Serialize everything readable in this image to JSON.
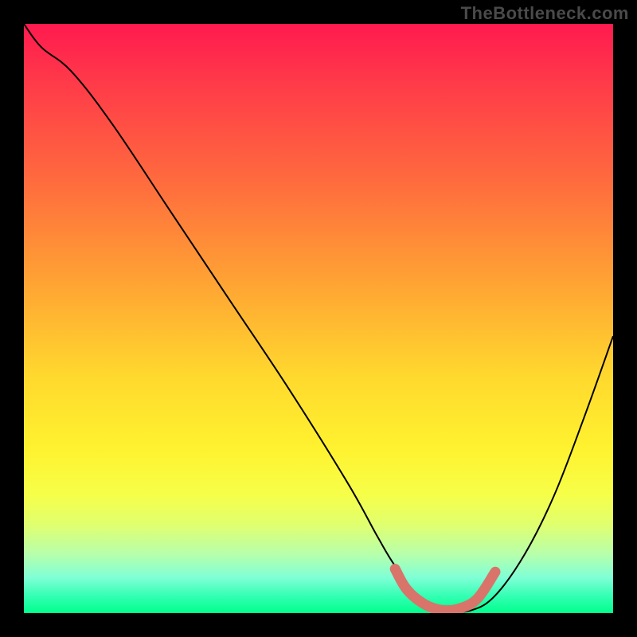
{
  "watermark": "TheBottleneck.com",
  "chart_data": {
    "type": "line",
    "title": "",
    "xlabel": "",
    "ylabel": "",
    "xlim": [
      0,
      100
    ],
    "ylim": [
      0,
      100
    ],
    "background_gradient": {
      "direction": "vertical",
      "stops": [
        {
          "pos": 0,
          "color": "#ff1a4f"
        },
        {
          "pos": 10,
          "color": "#ff3a49"
        },
        {
          "pos": 28,
          "color": "#ff6f3d"
        },
        {
          "pos": 45,
          "color": "#ffa733"
        },
        {
          "pos": 60,
          "color": "#ffd92e"
        },
        {
          "pos": 72,
          "color": "#fff22f"
        },
        {
          "pos": 80,
          "color": "#f6ff49"
        },
        {
          "pos": 85,
          "color": "#e0ff6f"
        },
        {
          "pos": 90,
          "color": "#b7ffab"
        },
        {
          "pos": 94,
          "color": "#7fffd6"
        },
        {
          "pos": 97,
          "color": "#35ffb4"
        },
        {
          "pos": 100,
          "color": "#00ff8c"
        }
      ]
    },
    "series": [
      {
        "name": "bottleneck-curve",
        "color": "#000000",
        "x": [
          0,
          3,
          8,
          15,
          25,
          35,
          45,
          55,
          60,
          63,
          67,
          72,
          76,
          80,
          85,
          90,
          95,
          100
        ],
        "values": [
          100,
          96,
          92,
          83,
          68,
          53,
          38,
          22,
          13,
          8,
          3,
          0.5,
          0.5,
          3,
          10,
          20,
          33,
          47
        ]
      },
      {
        "name": "optimal-zone-marker",
        "color": "#d9746a",
        "type": "segment",
        "x": [
          63,
          65,
          68,
          71,
          74,
          77,
          80
        ],
        "values": [
          7.5,
          4,
          1.5,
          0.5,
          0.8,
          2.5,
          7
        ],
        "stroke_width": 10,
        "linecap": "round"
      }
    ],
    "annotations": []
  }
}
